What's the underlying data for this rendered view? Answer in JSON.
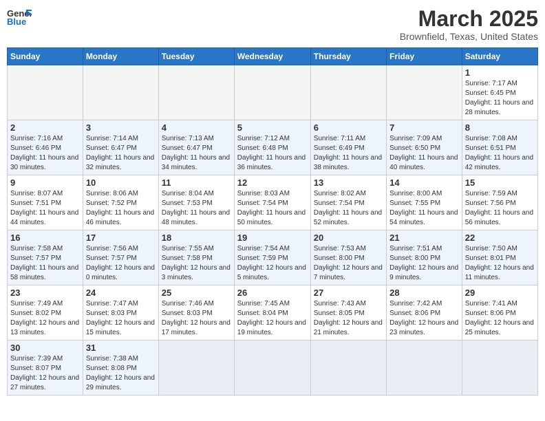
{
  "header": {
    "logo_text_normal": "General",
    "logo_text_colored": "Blue",
    "month_title": "March 2025",
    "location": "Brownfield, Texas, United States"
  },
  "days_of_week": [
    "Sunday",
    "Monday",
    "Tuesday",
    "Wednesday",
    "Thursday",
    "Friday",
    "Saturday"
  ],
  "weeks": [
    [
      {
        "day": "",
        "info": ""
      },
      {
        "day": "",
        "info": ""
      },
      {
        "day": "",
        "info": ""
      },
      {
        "day": "",
        "info": ""
      },
      {
        "day": "",
        "info": ""
      },
      {
        "day": "",
        "info": ""
      },
      {
        "day": "1",
        "info": "Sunrise: 7:17 AM\nSunset: 6:45 PM\nDaylight: 11 hours and 28 minutes."
      }
    ],
    [
      {
        "day": "2",
        "info": "Sunrise: 7:16 AM\nSunset: 6:46 PM\nDaylight: 11 hours and 30 minutes."
      },
      {
        "day": "3",
        "info": "Sunrise: 7:14 AM\nSunset: 6:47 PM\nDaylight: 11 hours and 32 minutes."
      },
      {
        "day": "4",
        "info": "Sunrise: 7:13 AM\nSunset: 6:47 PM\nDaylight: 11 hours and 34 minutes."
      },
      {
        "day": "5",
        "info": "Sunrise: 7:12 AM\nSunset: 6:48 PM\nDaylight: 11 hours and 36 minutes."
      },
      {
        "day": "6",
        "info": "Sunrise: 7:11 AM\nSunset: 6:49 PM\nDaylight: 11 hours and 38 minutes."
      },
      {
        "day": "7",
        "info": "Sunrise: 7:09 AM\nSunset: 6:50 PM\nDaylight: 11 hours and 40 minutes."
      },
      {
        "day": "8",
        "info": "Sunrise: 7:08 AM\nSunset: 6:51 PM\nDaylight: 11 hours and 42 minutes."
      }
    ],
    [
      {
        "day": "9",
        "info": "Sunrise: 8:07 AM\nSunset: 7:51 PM\nDaylight: 11 hours and 44 minutes."
      },
      {
        "day": "10",
        "info": "Sunrise: 8:06 AM\nSunset: 7:52 PM\nDaylight: 11 hours and 46 minutes."
      },
      {
        "day": "11",
        "info": "Sunrise: 8:04 AM\nSunset: 7:53 PM\nDaylight: 11 hours and 48 minutes."
      },
      {
        "day": "12",
        "info": "Sunrise: 8:03 AM\nSunset: 7:54 PM\nDaylight: 11 hours and 50 minutes."
      },
      {
        "day": "13",
        "info": "Sunrise: 8:02 AM\nSunset: 7:54 PM\nDaylight: 11 hours and 52 minutes."
      },
      {
        "day": "14",
        "info": "Sunrise: 8:00 AM\nSunset: 7:55 PM\nDaylight: 11 hours and 54 minutes."
      },
      {
        "day": "15",
        "info": "Sunrise: 7:59 AM\nSunset: 7:56 PM\nDaylight: 11 hours and 56 minutes."
      }
    ],
    [
      {
        "day": "16",
        "info": "Sunrise: 7:58 AM\nSunset: 7:57 PM\nDaylight: 11 hours and 58 minutes."
      },
      {
        "day": "17",
        "info": "Sunrise: 7:56 AM\nSunset: 7:57 PM\nDaylight: 12 hours and 0 minutes."
      },
      {
        "day": "18",
        "info": "Sunrise: 7:55 AM\nSunset: 7:58 PM\nDaylight: 12 hours and 3 minutes."
      },
      {
        "day": "19",
        "info": "Sunrise: 7:54 AM\nSunset: 7:59 PM\nDaylight: 12 hours and 5 minutes."
      },
      {
        "day": "20",
        "info": "Sunrise: 7:53 AM\nSunset: 8:00 PM\nDaylight: 12 hours and 7 minutes."
      },
      {
        "day": "21",
        "info": "Sunrise: 7:51 AM\nSunset: 8:00 PM\nDaylight: 12 hours and 9 minutes."
      },
      {
        "day": "22",
        "info": "Sunrise: 7:50 AM\nSunset: 8:01 PM\nDaylight: 12 hours and 11 minutes."
      }
    ],
    [
      {
        "day": "23",
        "info": "Sunrise: 7:49 AM\nSunset: 8:02 PM\nDaylight: 12 hours and 13 minutes."
      },
      {
        "day": "24",
        "info": "Sunrise: 7:47 AM\nSunset: 8:03 PM\nDaylight: 12 hours and 15 minutes."
      },
      {
        "day": "25",
        "info": "Sunrise: 7:46 AM\nSunset: 8:03 PM\nDaylight: 12 hours and 17 minutes."
      },
      {
        "day": "26",
        "info": "Sunrise: 7:45 AM\nSunset: 8:04 PM\nDaylight: 12 hours and 19 minutes."
      },
      {
        "day": "27",
        "info": "Sunrise: 7:43 AM\nSunset: 8:05 PM\nDaylight: 12 hours and 21 minutes."
      },
      {
        "day": "28",
        "info": "Sunrise: 7:42 AM\nSunset: 8:06 PM\nDaylight: 12 hours and 23 minutes."
      },
      {
        "day": "29",
        "info": "Sunrise: 7:41 AM\nSunset: 8:06 PM\nDaylight: 12 hours and 25 minutes."
      }
    ],
    [
      {
        "day": "30",
        "info": "Sunrise: 7:39 AM\nSunset: 8:07 PM\nDaylight: 12 hours and 27 minutes."
      },
      {
        "day": "31",
        "info": "Sunrise: 7:38 AM\nSunset: 8:08 PM\nDaylight: 12 hours and 29 minutes."
      },
      {
        "day": "",
        "info": ""
      },
      {
        "day": "",
        "info": ""
      },
      {
        "day": "",
        "info": ""
      },
      {
        "day": "",
        "info": ""
      },
      {
        "day": "",
        "info": ""
      }
    ]
  ]
}
